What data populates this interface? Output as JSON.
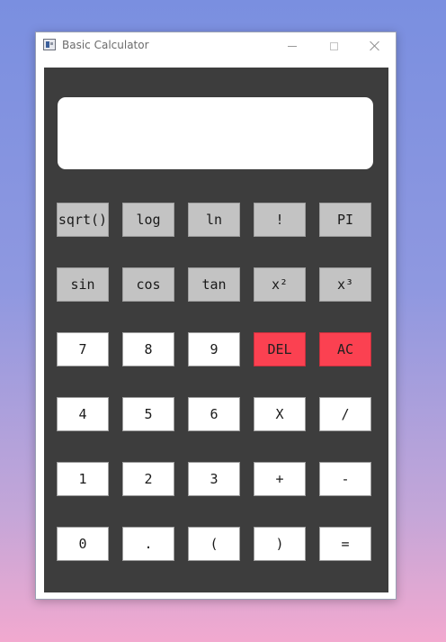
{
  "window": {
    "title": "Basic Calculator"
  },
  "display": {
    "value": ""
  },
  "keypad": {
    "row1": [
      "sqrt()",
      "log",
      "ln",
      "!",
      "PI"
    ],
    "row2": [
      "sin",
      "cos",
      "tan",
      "x²",
      "x³"
    ],
    "row3": [
      "7",
      "8",
      "9",
      "DEL",
      "AC"
    ],
    "row4": [
      "4",
      "5",
      "6",
      "X",
      "/"
    ],
    "row5": [
      "1",
      "2",
      "3",
      "+",
      "-"
    ],
    "row6": [
      "0",
      ".",
      "(",
      ")",
      "="
    ]
  },
  "colors": {
    "panel": "#3d3d3d",
    "function_key": "#c3c3c3",
    "number_key": "#ffffff",
    "danger_key": "#fb4151"
  }
}
